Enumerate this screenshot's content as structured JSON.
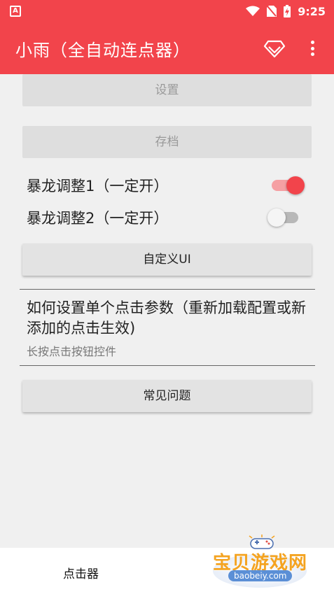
{
  "status_bar": {
    "app_icon_letter": "A",
    "time": "9:25"
  },
  "app_bar": {
    "title": "小雨（全自动连点器）"
  },
  "buttons": {
    "settings": "设置",
    "save": "存档",
    "custom_ui": "自定义UI",
    "faq": "常见问题"
  },
  "switches": [
    {
      "label": "暴龙调整1（一定开）",
      "on": true
    },
    {
      "label": "暴龙调整2（一定开）",
      "on": false
    }
  ],
  "help": {
    "title": "如何设置单个点击参数（重新加载配置或新添加的点击生效)",
    "subtitle": "长按点击按钮控件"
  },
  "bottom_nav": {
    "item": "点击器"
  },
  "watermark": {
    "text": "宝贝游戏网",
    "url": "baobeiy.com"
  },
  "colors": {
    "accent": "#f2444b",
    "background": "#f0f0f0"
  }
}
